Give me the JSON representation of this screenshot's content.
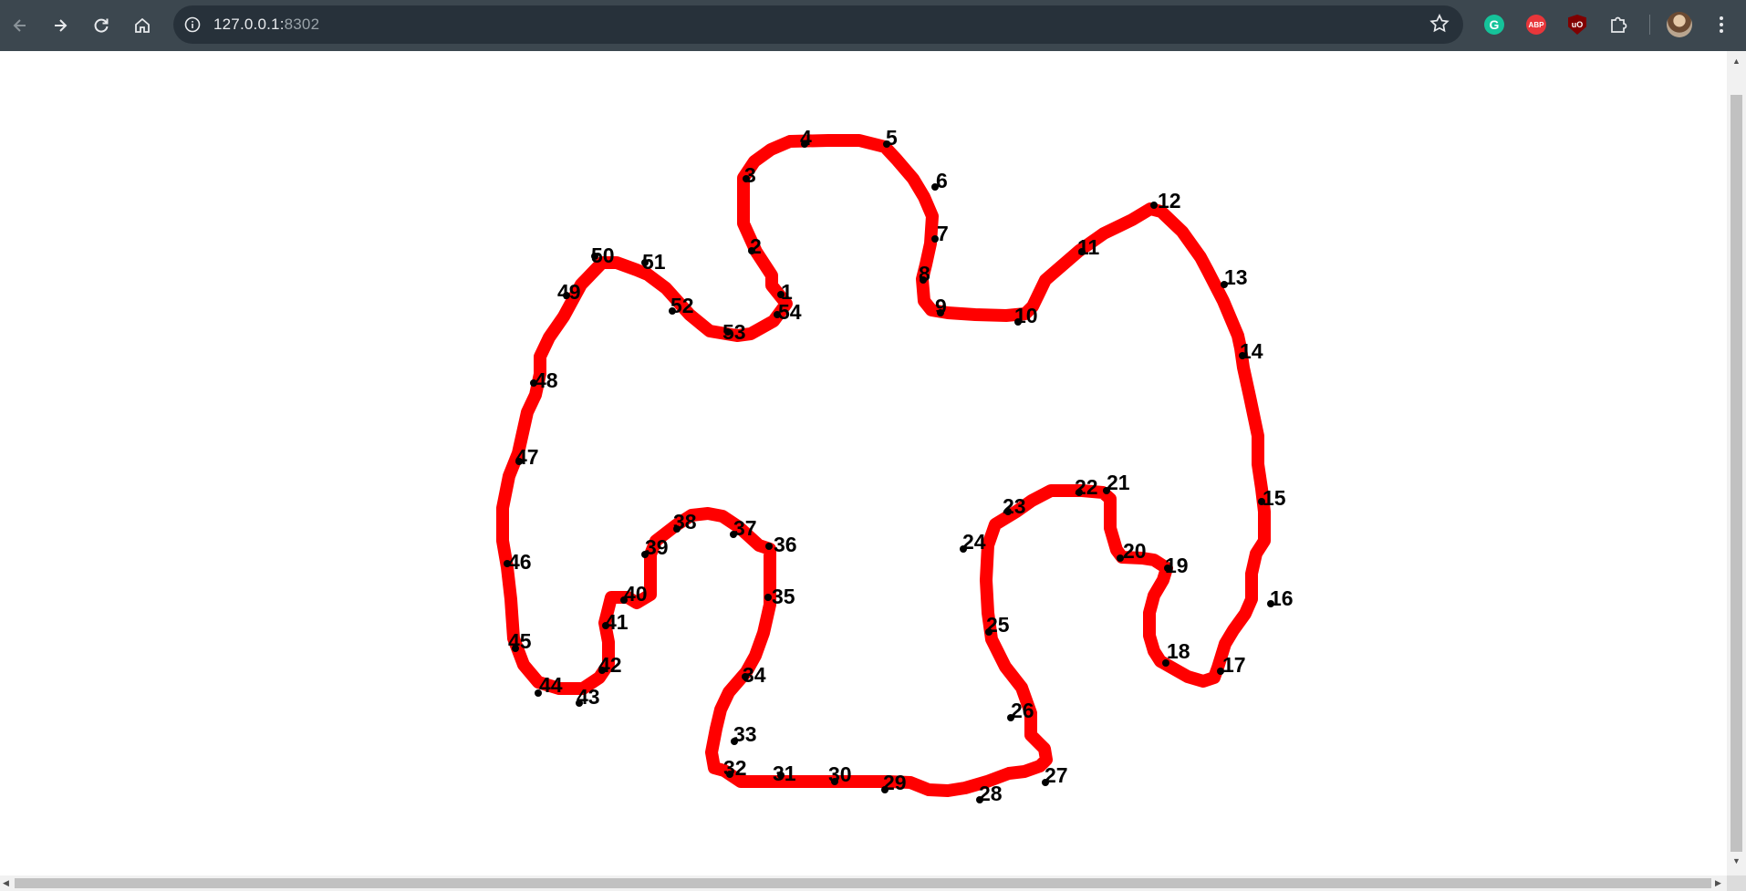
{
  "browser": {
    "url_host": "127.0.0.1:",
    "url_port": "8302",
    "icons": {
      "back": "back-arrow-icon",
      "forward": "forward-arrow-icon",
      "reload": "reload-icon",
      "home": "home-icon",
      "site_info": "info-icon",
      "bookmark": "star-icon",
      "extensions": "puzzle-piece-icon",
      "menu": "kebab-menu-icon"
    },
    "extensions": [
      {
        "name": "grammarly",
        "label": "G",
        "color": "#15c39a"
      },
      {
        "name": "adblock-plus",
        "label": "ABP",
        "color": "#e8363a"
      },
      {
        "name": "ublock-origin",
        "label": "uO",
        "color": "#800000"
      }
    ],
    "colors": {
      "toolbar": "#3c474f",
      "omnibox": "#27313a"
    }
  },
  "drawing": {
    "stroke_color": "#ff0000",
    "dot_color": "#000000",
    "points": [
      {
        "label": "1"
      },
      {
        "label": "2"
      },
      {
        "label": "3"
      },
      {
        "label": "4"
      },
      {
        "label": "5"
      },
      {
        "label": "6"
      },
      {
        "label": "7"
      },
      {
        "label": "8"
      },
      {
        "label": "9"
      },
      {
        "label": "10"
      },
      {
        "label": "11"
      },
      {
        "label": "12"
      },
      {
        "label": "13"
      },
      {
        "label": "14"
      },
      {
        "label": "15"
      },
      {
        "label": "16"
      },
      {
        "label": "17"
      },
      {
        "label": "18"
      },
      {
        "label": "19"
      },
      {
        "label": "20"
      },
      {
        "label": "21"
      },
      {
        "label": "22"
      },
      {
        "label": "23"
      },
      {
        "label": "24"
      },
      {
        "label": "25"
      },
      {
        "label": "26"
      },
      {
        "label": "27"
      },
      {
        "label": "28"
      },
      {
        "label": "29"
      },
      {
        "label": "30"
      },
      {
        "label": "31"
      },
      {
        "label": "32"
      },
      {
        "label": "33"
      },
      {
        "label": "34"
      },
      {
        "label": "35"
      },
      {
        "label": "36"
      },
      {
        "label": "37"
      },
      {
        "label": "38"
      },
      {
        "label": "39"
      },
      {
        "label": "40"
      },
      {
        "label": "41"
      },
      {
        "label": "42"
      },
      {
        "label": "43"
      },
      {
        "label": "44"
      },
      {
        "label": "45"
      },
      {
        "label": "46"
      },
      {
        "label": "47"
      },
      {
        "label": "48"
      },
      {
        "label": "49"
      },
      {
        "label": "50"
      },
      {
        "label": "51"
      },
      {
        "label": "52"
      },
      {
        "label": "53"
      },
      {
        "label": "54"
      }
    ]
  }
}
